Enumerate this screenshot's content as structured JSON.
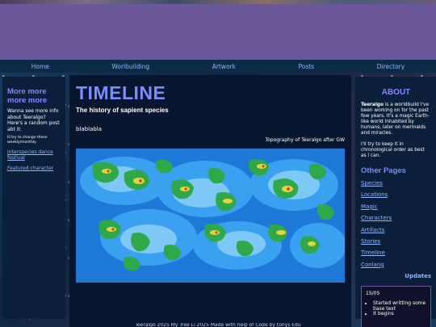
{
  "nav": {
    "items": [
      "Home",
      "Worlbuilding",
      "Artwork",
      "Posts",
      "Directory"
    ]
  },
  "left": {
    "title": "More more more more",
    "text": "Wanna see more info about Teeralgo? Here's a random post abt it:",
    "small": "Ill try to change these weekly/monthly",
    "links": [
      "Interspecies dance festival",
      "Featured character"
    ]
  },
  "main": {
    "title": "TIMELINE",
    "subtitle": "The history of sapient species",
    "body": "blablabla",
    "caption": "Topography of Teeralgo after GW"
  },
  "right": {
    "about_title": "ABOUT",
    "about_name": "Teeralgo",
    "about_text": " is a worldbuild I've been working on for the past few years. It's a magic Earth-like world inhabited by humans, later on mermaids and miracles.",
    "about_text2": "I'll try to keep it in chronological order as best as I can.",
    "pages_title": "Other Pages",
    "pages": [
      "Species",
      "Locations",
      "Magic",
      "Characters",
      "Artifacts",
      "Stories",
      "Timeline",
      "Conlang"
    ],
    "updates_title": "Updates",
    "update_date": "15/05",
    "update_items": [
      "Started writting some base text",
      "It begins"
    ]
  },
  "footer": {
    "text": "Teeralgo 2025 My Tree Li 2025 Made with help of Code by tonys Edu"
  },
  "colors": {
    "banner": "#6a589a",
    "accent": "#7a8cff",
    "link": "#8fb8ff",
    "panel": "#0b1f3a"
  }
}
